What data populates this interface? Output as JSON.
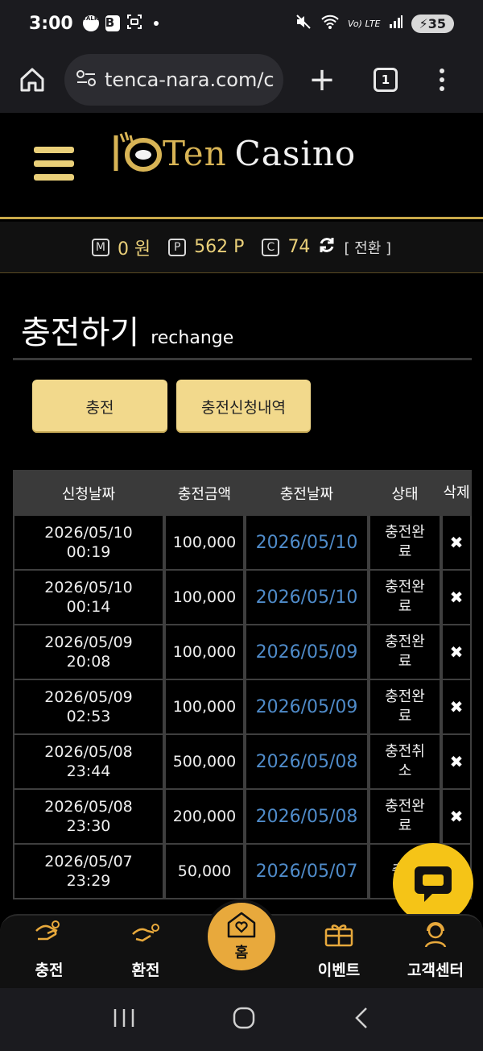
{
  "status": {
    "time": "3:00",
    "talk": "TALK",
    "b": "B",
    "network": "Vo) LTE",
    "battery": "35"
  },
  "browser": {
    "url": "tenca-nara.com/c",
    "tab_count": "1"
  },
  "brand": {
    "ten": "Ten",
    "casino": "Casino",
    "accent": "#d8b455"
  },
  "balance": {
    "m_icon": "M",
    "m_value": "0 원",
    "p_icon": "P",
    "p_value": "562 P",
    "c_icon": "C",
    "c_value": "74",
    "convert": "[ 전환 ]"
  },
  "page": {
    "title_ko": "충전하기",
    "title_en": "rechange"
  },
  "buttons": {
    "charge": "충전",
    "history": "충전신청내역"
  },
  "table": {
    "headers": [
      "신청날짜",
      "충전금액",
      "충전날짜",
      "상태",
      "삭제"
    ],
    "delete_glyph": "✖",
    "rows": [
      {
        "date": "2026/05/10",
        "time": "00:19",
        "amount": "100,000",
        "charged": "2026/05/10",
        "status_1": "충전완",
        "status_2": "료"
      },
      {
        "date": "2026/05/10",
        "time": "00:14",
        "amount": "100,000",
        "charged": "2026/05/10",
        "status_1": "충전완",
        "status_2": "료"
      },
      {
        "date": "2026/05/09",
        "time": "20:08",
        "amount": "100,000",
        "charged": "2026/05/09",
        "status_1": "충전완",
        "status_2": "료"
      },
      {
        "date": "2026/05/09",
        "time": "02:53",
        "amount": "100,000",
        "charged": "2026/05/09",
        "status_1": "충전완",
        "status_2": "료"
      },
      {
        "date": "2026/05/08",
        "time": "23:44",
        "amount": "500,000",
        "charged": "2026/05/08",
        "status_1": "충전취",
        "status_2": "소"
      },
      {
        "date": "2026/05/08",
        "time": "23:30",
        "amount": "200,000",
        "charged": "2026/05/08",
        "status_1": "충전완",
        "status_2": "료"
      },
      {
        "date": "2026/05/07",
        "time": "23:29",
        "amount": "50,000",
        "charged": "2026/05/07",
        "status_1": "충전",
        "status_2": ""
      }
    ]
  },
  "nav": {
    "charge": "충전",
    "exchange": "환전",
    "home": "홈",
    "event": "이벤트",
    "support": "고객센터"
  }
}
